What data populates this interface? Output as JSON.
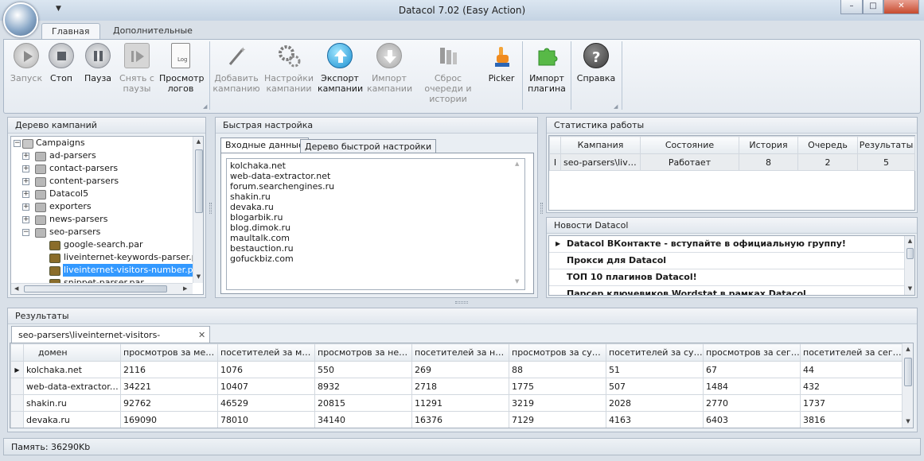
{
  "window": {
    "title": "Datacol 7.02 (Easy Action)",
    "qat_arrow": "▼",
    "controls": [
      "–",
      "□",
      "✕"
    ]
  },
  "ribbon_tabs": [
    {
      "label": "Главная",
      "active": true
    },
    {
      "label": "Дополнительные",
      "active": false
    }
  ],
  "ribbon": {
    "buttons": [
      {
        "label": "Запуск",
        "icon": "play-icon",
        "enabled": false
      },
      {
        "label": "Стоп",
        "icon": "stop-icon",
        "enabled": true
      },
      {
        "label": "Пауза",
        "icon": "pause-icon",
        "enabled": true
      },
      {
        "label": "Снять с паузы",
        "icon": "resume-icon",
        "enabled": false
      },
      {
        "label": "Просмотр логов",
        "icon": "log-file-icon",
        "enabled": true
      },
      {
        "label": "Добавить кампанию",
        "icon": "magic-wand-icon",
        "enabled": false
      },
      {
        "label": "Настройки кампании",
        "icon": "gears-icon",
        "enabled": false
      },
      {
        "label": "Экспорт кампании",
        "icon": "upload-icon",
        "enabled": true
      },
      {
        "label": "Импорт кампании",
        "icon": "download-icon",
        "enabled": false
      },
      {
        "label": "Сброс очереди и истории",
        "icon": "reset-queue-icon",
        "enabled": false
      },
      {
        "label": "Picker",
        "icon": "pointing-hand-icon",
        "enabled": true
      },
      {
        "label": "Импорт плагина",
        "icon": "puzzle-icon",
        "enabled": true
      },
      {
        "label": "Справка",
        "icon": "help-icon",
        "enabled": true
      }
    ]
  },
  "campaign_tree": {
    "title": "Дерево кампаний",
    "root": "Campaigns",
    "folders": [
      "ad-parsers",
      "contact-parsers",
      "content-parsers",
      "Datacol5",
      "exporters",
      "news-parsers",
      "seo-parsers"
    ],
    "children": [
      "google-search.par",
      "liveinternet-keywords-parser.par",
      "liveinternet-visitors-number.par",
      "snippet-parser.par"
    ],
    "selected": "liveinternet-visitors-number.par"
  },
  "quick_setup": {
    "title": "Быстрая настройка",
    "tabs": [
      "Входные данные",
      "Дерево быстрой настройки"
    ],
    "lines": [
      "kolchaka.net",
      "web-data-extractor.net",
      "forum.searchengines.ru",
      "shakin.ru",
      "devaka.ru",
      "blogarbik.ru",
      "blog.dimok.ru",
      "maultalk.com",
      "bestauction.ru",
      "gofuckbiz.com"
    ]
  },
  "stats": {
    "title": "Статистика работы",
    "columns": [
      "Кампания",
      "Состояние",
      "История",
      "Очередь",
      "Результаты"
    ],
    "row_marker": "I",
    "row": [
      "seo-parsers\\livei...",
      "Работает",
      "8",
      "2",
      "5"
    ]
  },
  "news": {
    "title": "Новости Datacol",
    "items": [
      "Datacol ВКонтакте - вступайте в официальную группу!",
      "Прокси для Datacol",
      "ТОП 10 плагинов Datacol!",
      "Парсер ключевиков Wordstat в рамках Datacol"
    ]
  },
  "results": {
    "title": "Результаты",
    "tab": "seo-parsers\\liveinternet-visitors-number.par",
    "tab_close": "✕",
    "columns": [
      "домен",
      "просмотров за месяц",
      "посетителей за месяц",
      "просмотров за недел...",
      "посетителей за недел...",
      "просмотров за сутки",
      "посетителей за сутки",
      "просмотров за сегод...",
      "посетителей за сегод..."
    ],
    "rows": [
      [
        "kolchaka.net",
        "2116",
        "1076",
        "550",
        "269",
        "88",
        "51",
        "67",
        "44"
      ],
      [
        "web-data-extractor.net",
        "34221",
        "10407",
        "8932",
        "2718",
        "1775",
        "507",
        "1484",
        "432"
      ],
      [
        "shakin.ru",
        "92762",
        "46529",
        "20815",
        "11291",
        "3219",
        "2028",
        "2770",
        "1737"
      ],
      [
        "devaka.ru",
        "169090",
        "78010",
        "34140",
        "16376",
        "7129",
        "4163",
        "6403",
        "3816"
      ]
    ]
  },
  "status": {
    "memory": "Память: 36290Kb"
  }
}
